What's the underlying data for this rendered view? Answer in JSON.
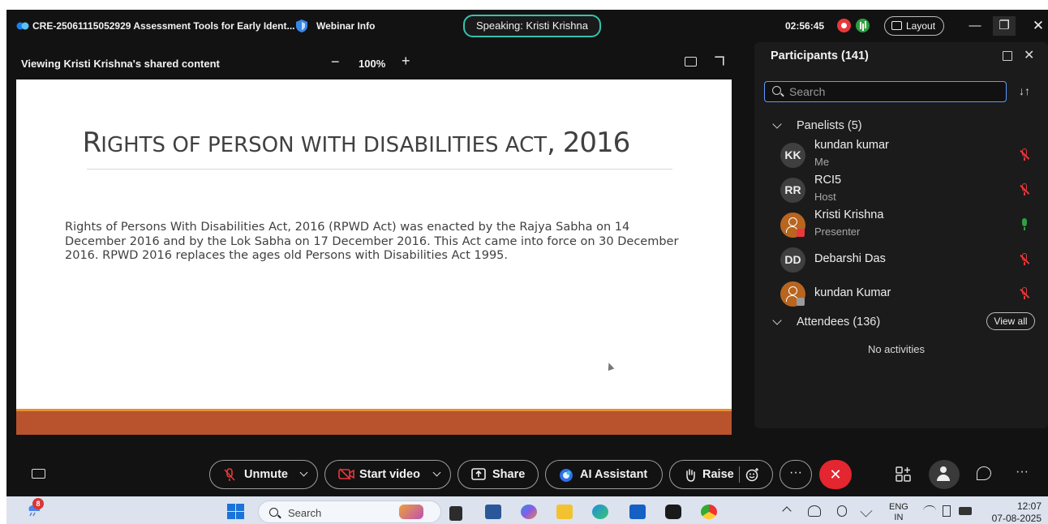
{
  "titlebar": {
    "meeting_title": "CRE-25061115052929 Assessment Tools for Early Ident...",
    "webinar_info": "Webinar Info",
    "speaking": "Speaking: Kristi Krishna",
    "clock": "02:56:45",
    "layout_label": "Layout"
  },
  "share_bar": {
    "viewing_text": "Viewing Kristi Krishna's shared content",
    "zoom_minus": "−",
    "zoom_level": "100%",
    "zoom_plus": "+"
  },
  "slide": {
    "title_first": "R",
    "title_smallcaps": "IGHTS OF PERSON WITH DISABILITIES ACT",
    "title_year": ", 2016",
    "body": "Rights of Persons With Disabilities Act, 2016 (RPWD Act) was enacted by the Rajya Sabha on 14 December 2016 and by the Lok Sabha on 17 December 2016. This Act came into force on 30 December 2016. RPWD 2016 replaces the ages old Persons with Disabilities Act 1995.",
    "accent_colors": {
      "band": "#b8532e",
      "band_top": "#e98f2f"
    }
  },
  "panel": {
    "title": "Participants (141)",
    "search_placeholder": "Search",
    "panelists_header": "Panelists (5)",
    "panelists": [
      {
        "initials": "KK",
        "name": "kundan kumar",
        "role": "Me",
        "mic": "muted"
      },
      {
        "initials": "RR",
        "name": "RCI5",
        "role": "Host",
        "mic": "muted"
      },
      {
        "initials": "",
        "name": "Kristi Krishna",
        "role": "Presenter",
        "mic": "active"
      },
      {
        "initials": "DD",
        "name": "Debarshi Das",
        "role": "",
        "mic": "muted"
      },
      {
        "initials": "",
        "name": "kundan Kumar",
        "role": "",
        "mic": "muted"
      }
    ],
    "attendees_header": "Attendees (136)",
    "view_all": "View all",
    "no_activities": "No activities"
  },
  "controls": {
    "unmute": "Unmute",
    "start_video": "Start video",
    "share": "Share",
    "ai_assistant": "AI Assistant",
    "raise": "Raise",
    "more": "···",
    "end": "✕"
  },
  "taskbar": {
    "weather_badge": "8",
    "search_label": "Search",
    "lang_top": "ENG",
    "lang_bottom": "IN",
    "time": "12:07",
    "date": "07-08-2025"
  }
}
